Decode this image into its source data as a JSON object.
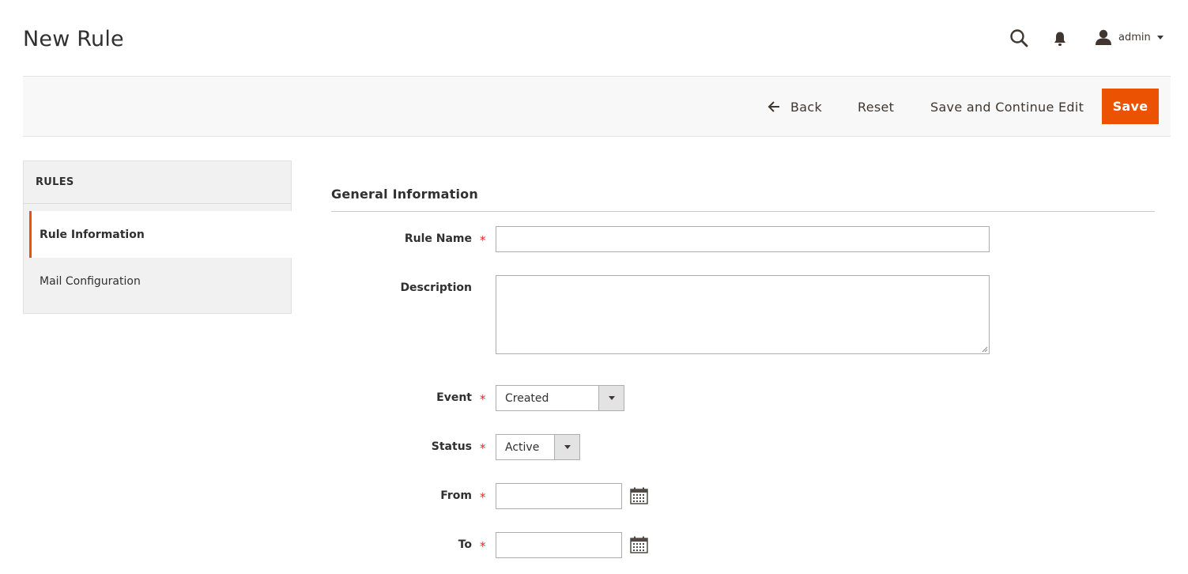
{
  "header": {
    "title": "New Rule",
    "user_name": "admin",
    "icons": [
      "search-icon",
      "bell-icon",
      "user-icon",
      "chevron-down-icon"
    ]
  },
  "actions": {
    "back_label": "Back",
    "reset_label": "Reset",
    "save_continue_label": "Save and Continue Edit",
    "save_label": "Save"
  },
  "sidebar": {
    "title": "RULES",
    "items": [
      {
        "label": "Rule Information",
        "active": true
      },
      {
        "label": "Mail Configuration",
        "active": false
      }
    ]
  },
  "form": {
    "section_title": "General Information",
    "rule_name": {
      "label": "Rule Name",
      "required": true,
      "value": ""
    },
    "description": {
      "label": "Description",
      "required": false,
      "value": ""
    },
    "event": {
      "label": "Event",
      "required": true,
      "value": "Created"
    },
    "status": {
      "label": "Status",
      "required": true,
      "value": "Active"
    },
    "from": {
      "label": "From",
      "required": true,
      "value": ""
    },
    "to": {
      "label": "To",
      "required": true,
      "value": ""
    },
    "required_mark": "*"
  },
  "colors": {
    "accent": "#eb5202",
    "required": "#e22626",
    "text": "#303030",
    "bar_bg": "#f8f8f8",
    "sidebar_bg": "#f1f1f1"
  }
}
